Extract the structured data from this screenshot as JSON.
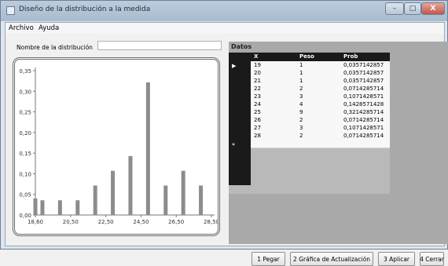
{
  "window": {
    "title": "Diseño de la distribución a la medida"
  },
  "menu": [
    "Archivo",
    "Ayuda"
  ],
  "name_label": "Nombre de la distribución",
  "name_value": "",
  "datos": {
    "title": "Datos",
    "headers": [
      "X",
      "Peso",
      "Prob"
    ],
    "rows": [
      [
        "19",
        "1",
        "0,0357142857"
      ],
      [
        "20",
        "1",
        "0,0357142857"
      ],
      [
        "21",
        "1",
        "0,0357142857"
      ],
      [
        "22",
        "2",
        "0,0714285714"
      ],
      [
        "23",
        "3",
        "0,1071428571"
      ],
      [
        "24",
        "4",
        "0,1428571428"
      ],
      [
        "25",
        "9",
        "0,3214285714"
      ],
      [
        "26",
        "2",
        "0,0714285714"
      ],
      [
        "27",
        "3",
        "0,1071428571"
      ],
      [
        "28",
        "2",
        "0,0714285714"
      ]
    ]
  },
  "buttons": [
    "1 Pegar",
    "2 Gráfica de Actualización",
    "3 Aplicar",
    "4 Cerrar"
  ],
  "chart_data": {
    "type": "bar",
    "x": [
      18.6,
      19,
      20,
      21,
      22,
      23,
      24,
      25,
      26,
      27,
      28
    ],
    "values": [
      0.04,
      0.0357142857,
      0.0357142857,
      0.0357142857,
      0.0714285714,
      0.1071428571,
      0.1428571428,
      0.3214285714,
      0.0714285714,
      0.1071428571,
      0.0714285714
    ],
    "xticks": [
      "18,60",
      "20,50",
      "22,50",
      "24,50",
      "26,50",
      "28,50"
    ],
    "yticks": [
      "0,00",
      "0,05",
      "0,10",
      "0,15",
      "0,20",
      "0,25",
      "0,30",
      "0,35"
    ],
    "xlim": [
      18.6,
      28.6
    ],
    "ylim": [
      0,
      0.35
    ],
    "bar_color": "#8c8c8c"
  }
}
